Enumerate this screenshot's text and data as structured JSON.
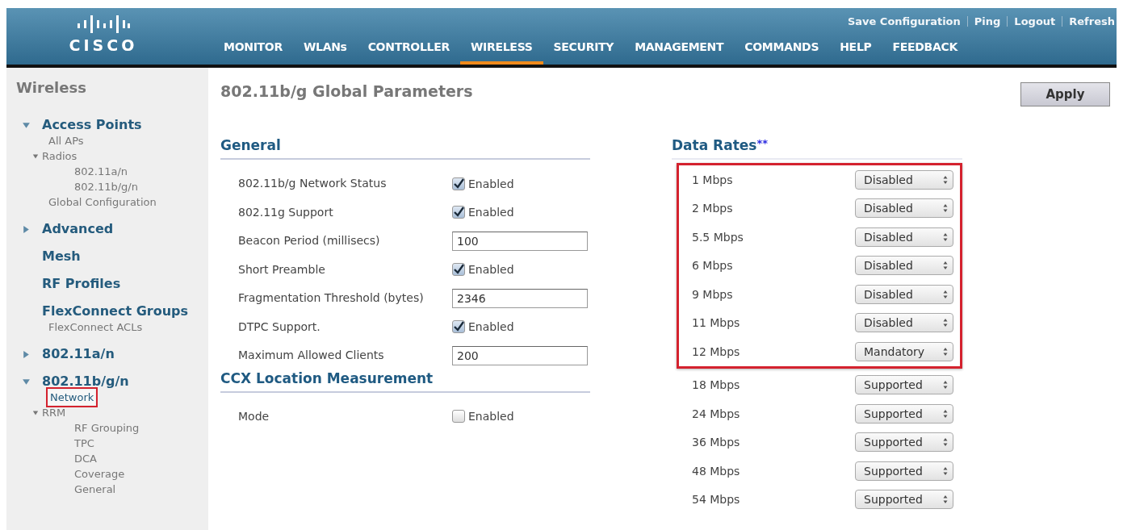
{
  "header": {
    "logo_text": "CISCO",
    "top_links": [
      "Save Configuration",
      "Ping",
      "Logout",
      "Refresh"
    ],
    "tabs": [
      {
        "label": "MONITOR",
        "selected": false
      },
      {
        "label": "WLANs",
        "selected": false
      },
      {
        "label": "CONTROLLER",
        "selected": false
      },
      {
        "label": "WIRELESS",
        "selected": true
      },
      {
        "label": "SECURITY",
        "selected": false
      },
      {
        "label": "MANAGEMENT",
        "selected": false
      },
      {
        "label": "COMMANDS",
        "selected": false
      },
      {
        "label": "HELP",
        "selected": false
      },
      {
        "label": "FEEDBACK",
        "selected": false
      }
    ]
  },
  "sidebar": {
    "title": "Wireless",
    "items": [
      {
        "label": "Access Points",
        "expanded": true,
        "children": [
          {
            "label": "All APs"
          },
          {
            "label": "Radios",
            "expanded": true,
            "children": [
              {
                "label": "802.11a/n"
              },
              {
                "label": "802.11b/g/n"
              }
            ]
          },
          {
            "label": "Global Configuration"
          }
        ]
      },
      {
        "label": "Advanced",
        "expanded": false
      },
      {
        "label": "Mesh"
      },
      {
        "label": "RF Profiles"
      },
      {
        "label": "FlexConnect Groups",
        "children": [
          {
            "label": "FlexConnect ACLs"
          }
        ]
      },
      {
        "label": "802.11a/n",
        "expanded": false
      },
      {
        "label": "802.11b/g/n",
        "expanded": true,
        "children": [
          {
            "label": "Network",
            "highlighted": true
          },
          {
            "label": "RRM",
            "expanded": true,
            "children": [
              {
                "label": "RF Grouping"
              },
              {
                "label": "TPC"
              },
              {
                "label": "DCA"
              },
              {
                "label": "Coverage"
              },
              {
                "label": "General"
              }
            ]
          }
        ]
      }
    ]
  },
  "page": {
    "title": "802.11b/g Global Parameters",
    "apply_button": "Apply"
  },
  "general": {
    "title": "General",
    "rows": [
      {
        "label": "802.11b/g Network Status",
        "kind": "checkbox",
        "checked": true,
        "text": "Enabled"
      },
      {
        "label": "802.11g Support",
        "kind": "checkbox",
        "checked": true,
        "text": "Enabled"
      },
      {
        "label": "Beacon Period (millisecs)",
        "kind": "input",
        "value": "100"
      },
      {
        "label": "Short Preamble",
        "kind": "checkbox",
        "checked": true,
        "text": "Enabled"
      },
      {
        "label": "Fragmentation Threshold (bytes)",
        "kind": "input",
        "value": "2346"
      },
      {
        "label": "DTPC Support.",
        "kind": "checkbox",
        "checked": true,
        "text": "Enabled"
      },
      {
        "label": "Maximum Allowed Clients",
        "kind": "input",
        "value": "200"
      }
    ]
  },
  "ccx": {
    "title": "CCX Location Measurement",
    "rows": [
      {
        "label": "Mode",
        "kind": "checkbox",
        "checked": false,
        "text": "Enabled"
      }
    ]
  },
  "data_rates": {
    "title": "Data Rates",
    "title_mark": "**",
    "groups": [
      {
        "highlighted": true,
        "rates": [
          {
            "label": "1 Mbps",
            "value": "Disabled"
          },
          {
            "label": "2 Mbps",
            "value": "Disabled"
          },
          {
            "label": "5.5 Mbps",
            "value": "Disabled"
          },
          {
            "label": "6 Mbps",
            "value": "Disabled"
          },
          {
            "label": "9 Mbps",
            "value": "Disabled"
          },
          {
            "label": "11 Mbps",
            "value": "Disabled"
          },
          {
            "label": "12 Mbps",
            "value": "Mandatory"
          }
        ]
      },
      {
        "highlighted": false,
        "rates": [
          {
            "label": "18 Mbps",
            "value": "Supported"
          },
          {
            "label": "24 Mbps",
            "value": "Supported"
          },
          {
            "label": "36 Mbps",
            "value": "Supported"
          },
          {
            "label": "48 Mbps",
            "value": "Supported"
          },
          {
            "label": "54 Mbps",
            "value": "Supported"
          }
        ]
      }
    ]
  }
}
